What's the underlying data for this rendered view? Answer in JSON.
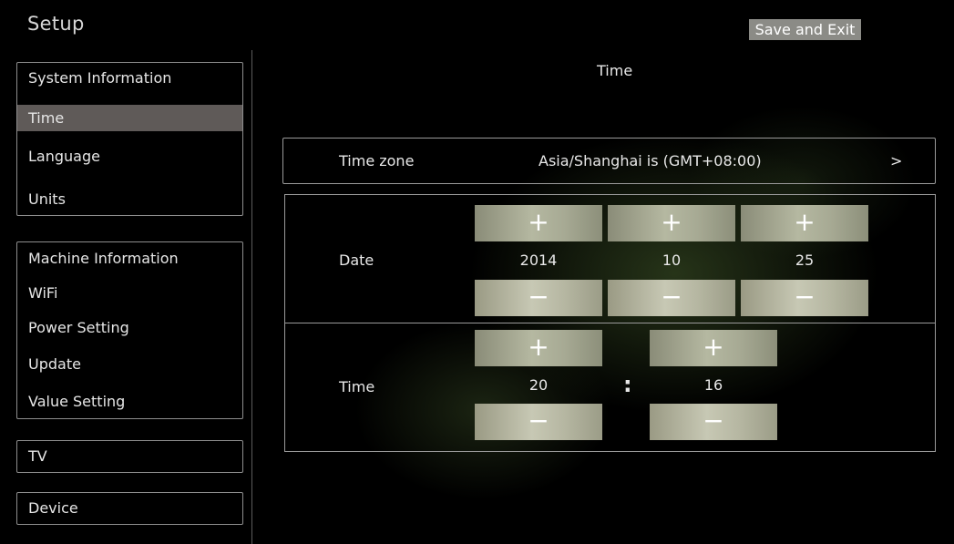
{
  "header": {
    "title": "Setup",
    "save_exit": "Save and Exit"
  },
  "sidebar": {
    "groups": [
      {
        "items": [
          "System Information",
          "Time",
          "Language",
          "Units"
        ],
        "selected": "Time"
      },
      {
        "items": [
          "Machine Information",
          "WiFi",
          "Power Setting",
          "Update",
          "Value Setting"
        ]
      },
      {
        "items": [
          "TV"
        ]
      },
      {
        "items": [
          "Device"
        ]
      }
    ]
  },
  "main": {
    "title": "Time",
    "timezone": {
      "label": "Time zone",
      "value": "Asia/Shanghai is (GMT+08:00)",
      "arrow": ">"
    },
    "date": {
      "label": "Date",
      "year": "2014",
      "month": "10",
      "day": "25"
    },
    "time": {
      "label": "Time",
      "hour": "20",
      "minute": "16",
      "separator": ":"
    },
    "increment_symbol": "+",
    "decrement_symbol": "−"
  }
}
